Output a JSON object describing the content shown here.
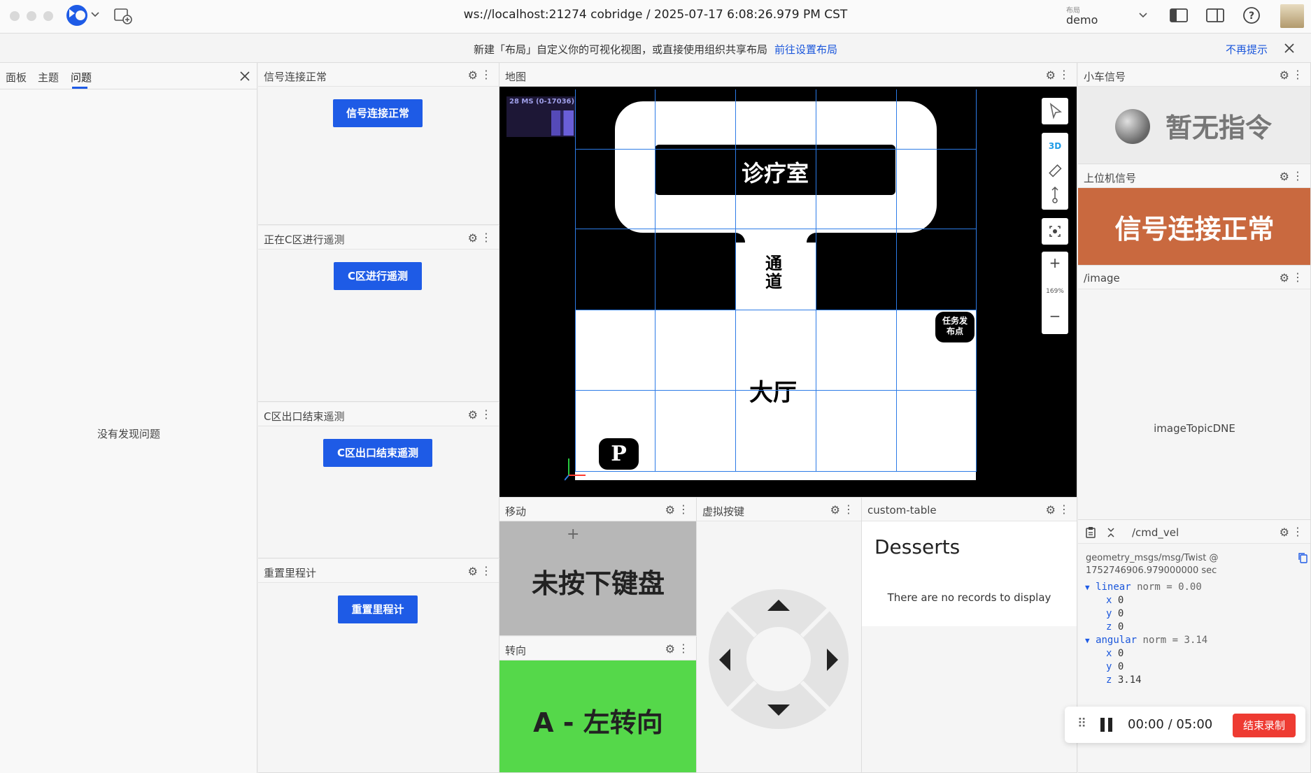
{
  "titlebar": {
    "connection": "ws://localhost:21274 cobridge / 2025-07-17 6:08:26.979 PM CST",
    "layout_label_small": "布局",
    "layout_name": "demo"
  },
  "notice": {
    "text": "新建「布局」自定义你的可视化视图，或直接使用组织共享布局",
    "link": "前往设置布局",
    "dismiss": "不再提示"
  },
  "left_panel": {
    "tabs": [
      "面板",
      "主题",
      "问题"
    ],
    "active_tab": "问题",
    "empty_text": "没有发现问题"
  },
  "panels": {
    "signal": {
      "title": "信号连接正常",
      "button": "信号连接正常"
    },
    "c_zone": {
      "title": "正在C区进行遥测",
      "button": "C区进行遥测"
    },
    "c_exit": {
      "title": "C区出口结束遥测",
      "button": "C区出口结束遥测"
    },
    "reset": {
      "title": "重置里程计",
      "button": "重置里程计"
    },
    "map": {
      "title": "地图",
      "perf": "28 MS (0-17036)",
      "labels": {
        "clinic": "诊疗室",
        "passage": "通道",
        "hall": "大厅",
        "task": "任务发布点",
        "parking": "P"
      },
      "mode_3d": "3D",
      "zoom": "169%"
    },
    "move": {
      "title": "移动",
      "status": "未按下键盘"
    },
    "turn": {
      "title": "转向",
      "status": "A - 左转向"
    },
    "vkeys": {
      "title": "虚拟按键"
    },
    "table": {
      "title": "custom-table",
      "heading": "Desserts",
      "empty": "There are no records to display"
    },
    "car_signal": {
      "title": "小车信号",
      "status": "暂无指令"
    },
    "host_signal": {
      "title": "上位机信号",
      "status": "信号连接正常"
    },
    "image": {
      "title": "/image",
      "placeholder": "imageTopicDNE"
    },
    "cmd_vel": {
      "topic": "/cmd_vel",
      "type_line1": "geometry_msgs/msg/Twist @",
      "type_line2": "1752746906.979000000 sec",
      "linear_key": "linear",
      "linear_norm": "norm = 0.00",
      "linear": {
        "x": "0",
        "y": "0",
        "z": "0"
      },
      "angular_key": "angular",
      "angular_norm": "norm = 3.14",
      "angular": {
        "x": "0",
        "y": "0",
        "z": "3.14"
      }
    }
  },
  "recorder": {
    "time": "00:00 / 05:00",
    "stop": "结束录制"
  },
  "colors": {
    "accent": "#1e5be6",
    "host_signal_bg": "#c9693f",
    "turn_bg": "#55d84a",
    "move_bg": "#b7b7b7",
    "record_stop": "#ee3b32"
  }
}
